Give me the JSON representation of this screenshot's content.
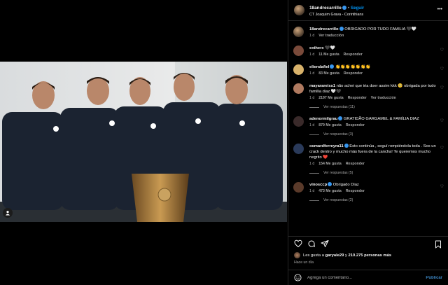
{
  "post": {
    "author": "18andrecarrillo",
    "follow_label": "Seguir",
    "location": "CT Joaquim Grava - Corinthians",
    "caption_author": "18andrecarrillo",
    "caption": "OBRIGADO POR TUDO FAMILIA 🖤🤍",
    "caption_time": "1 d",
    "caption_translate": "Ver traducción"
  },
  "comments": [
    {
      "user": "extherx",
      "text": "🖤🤍",
      "time": "1 d",
      "likes": "11 Me gusta",
      "reply": "Responder",
      "verified": false,
      "avatar_color": "#7a4a3a"
    },
    {
      "user": "eliendafiel",
      "text": "👏👏👏👏👏👏👏",
      "time": "1 d",
      "likes": "83 Me gusta",
      "reply": "Responder",
      "verified": true,
      "avatar_color": "#d8b26a"
    },
    {
      "user": "mayarareiss1",
      "text": "não achei que iria doer assim kkk 🥺 obrigada por tudo família diaz 🤍🖤",
      "time": "1 d",
      "likes": "2197 Me gusta",
      "reply": "Responder",
      "translate": "Ver traducción",
      "replies": "Ver respuestas (11)",
      "verified": false,
      "avatar_color": "#b07a60"
    },
    {
      "user": "adenormilgrau",
      "text": "GRATIDÃO GARGAMEL & FAMÍLIA DIAZ",
      "time": "1 d",
      "likes": "879 Me gusta",
      "reply": "Responder",
      "replies": "Ver respuestas (3)",
      "verified": true,
      "avatar_color": "#3a2a2a"
    },
    {
      "user": "osmardferreyra11",
      "text": "Esto continúa , seguí rompiéndola toda . Sos un crack dentro y mucho más fuera de la cancha! Te queremos mucho negrito ❤️",
      "time": "1 d",
      "likes": "154 Me gusta",
      "reply": "Responder",
      "replies": "Ver respuestas (5)",
      "verified": true,
      "avatar_color": "#2a3a5a"
    },
    {
      "user": "vinosccp",
      "text": "Obrigado Diaz",
      "time": "1 d",
      "likes": "473 Me gusta",
      "reply": "Responder",
      "replies": "Ver respuestas (2)",
      "verified": true,
      "avatar_color": "#5a3a2a"
    }
  ],
  "likes_line": {
    "prefix": "Les gusta a ",
    "user": "garyale29",
    "middle": " y ",
    "count": "210.275 personas más"
  },
  "posted_ago": "Hace un día",
  "composer": {
    "placeholder": "Agrega un comentario...",
    "publish_label": "Publicar"
  },
  "icons": {
    "like": "heart-icon",
    "comment": "comment-icon",
    "share": "share-icon",
    "save": "bookmark-icon",
    "emoji": "emoji-icon",
    "more": "more-options-icon",
    "tag": "user-tag-icon"
  },
  "colors": {
    "background": "#000000",
    "link": "#0095f6",
    "muted": "#a8a8a8",
    "verified": "#3897f0"
  }
}
